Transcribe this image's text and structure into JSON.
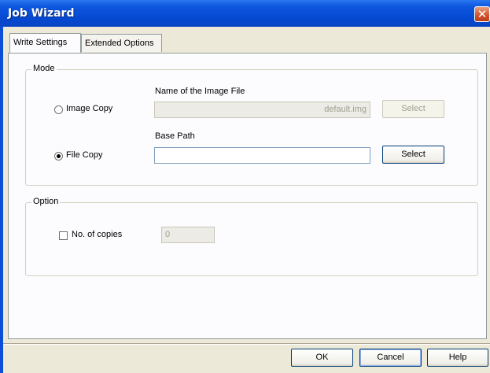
{
  "window": {
    "title": "Job Wizard"
  },
  "tabs": [
    {
      "label": "Write Settings",
      "active": true
    },
    {
      "label": "Extended Options",
      "active": false
    }
  ],
  "mode_group": {
    "label": "Mode",
    "image_copy": {
      "label": "Image Copy",
      "selected": false,
      "field_label": "Name of the Image File",
      "field_value": "default.img",
      "select_label": "Select",
      "enabled": false
    },
    "file_copy": {
      "label": "File Copy",
      "selected": true,
      "field_label": "Base Path",
      "field_value": "",
      "select_label": "Select",
      "enabled": true
    }
  },
  "option_group": {
    "label": "Option",
    "copies": {
      "label": "No. of copies",
      "checked": false,
      "value": "0"
    }
  },
  "footer": {
    "ok_label": "OK",
    "cancel_label": "Cancel",
    "help_label": "Help"
  },
  "colors": {
    "title_bar": "#0548d0",
    "dialog_bg": "#ece9d8",
    "close_button": "#d0502a"
  }
}
